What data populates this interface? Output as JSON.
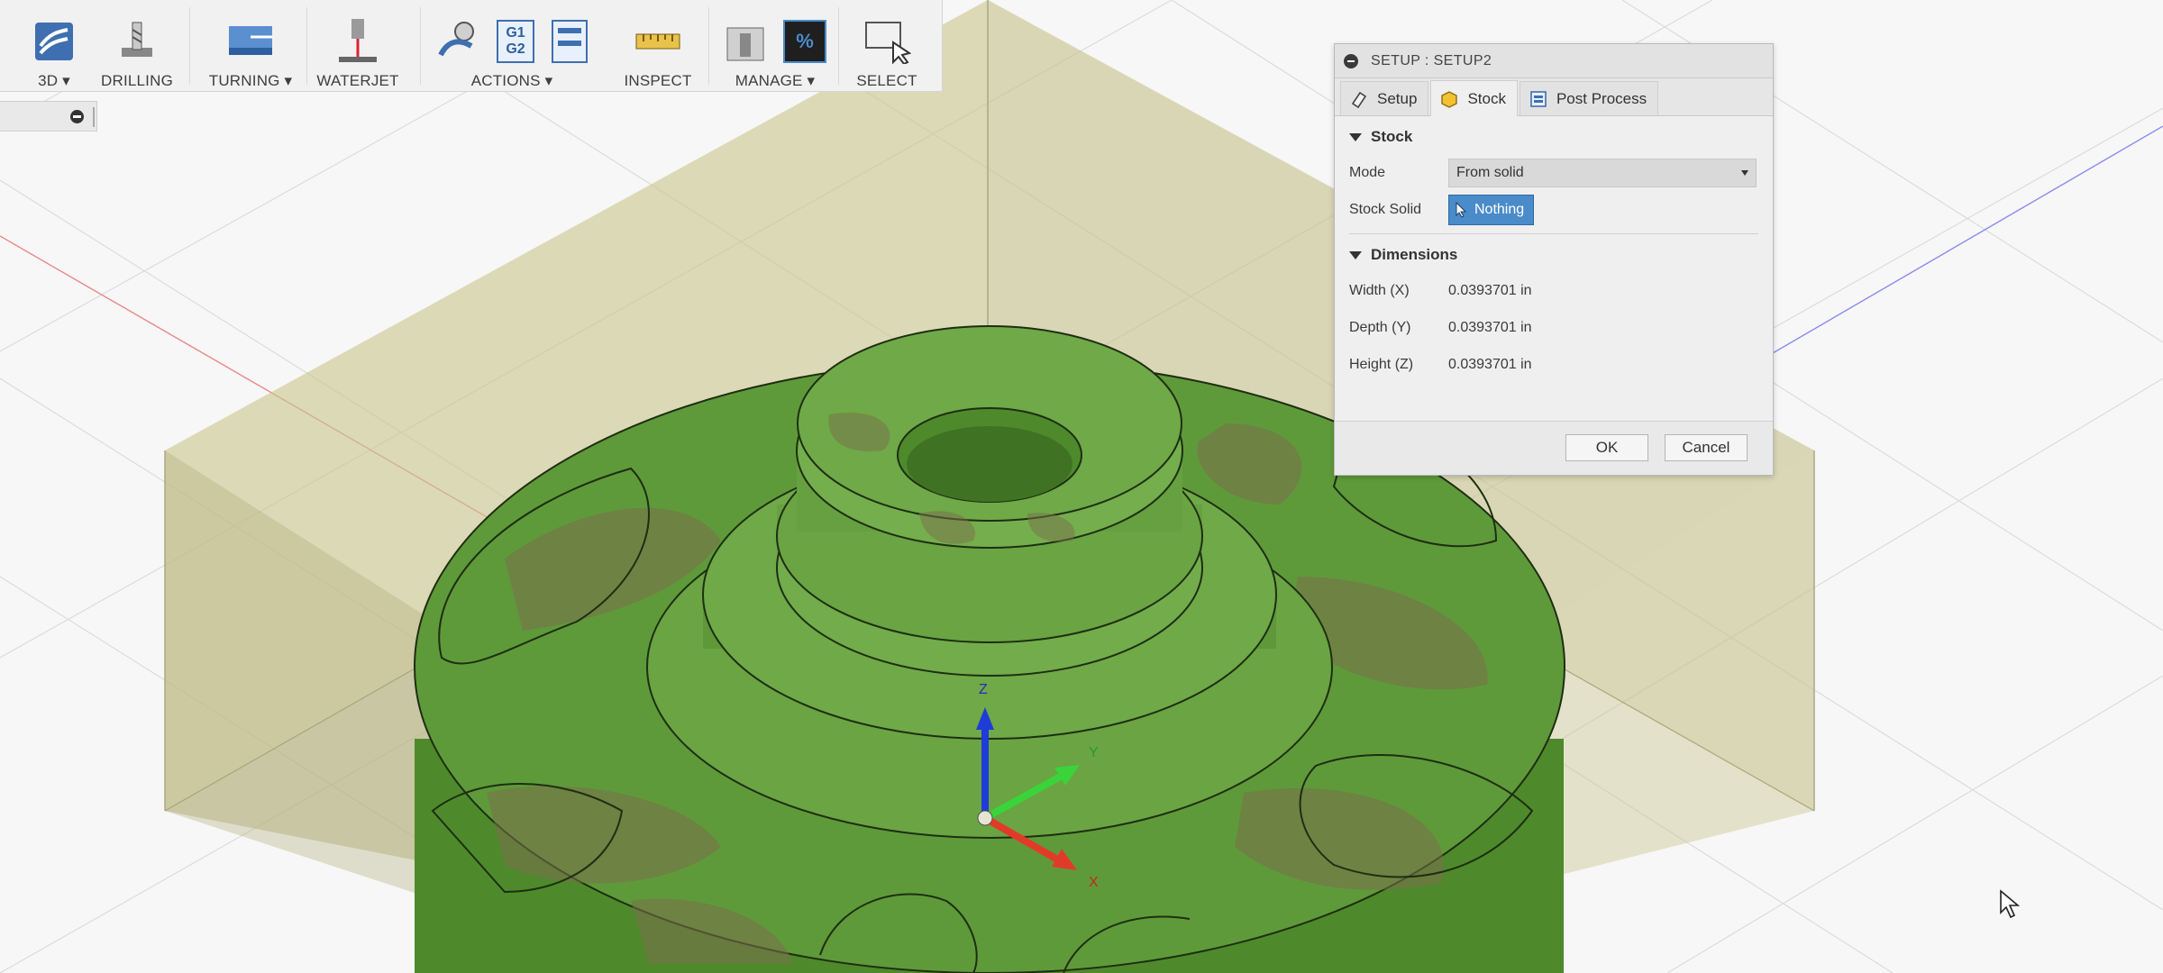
{
  "toolbar": {
    "items": [
      {
        "label": "3D ▾",
        "icon": "3d-milling-icon"
      },
      {
        "label": "DRILLING",
        "icon": "drill-icon"
      },
      {
        "label": "TURNING ▾",
        "icon": "turning-icon"
      },
      {
        "label": "WATERJET",
        "icon": "waterjet-icon"
      },
      {
        "label": "ACTIONS ▾",
        "icon": "simulate-icon"
      },
      {
        "label": "INSPECT",
        "icon": "measure-icon"
      },
      {
        "label": "MANAGE ▾",
        "icon": "tool-library-icon"
      },
      {
        "label": "SELECT",
        "icon": "select-icon"
      }
    ],
    "g1g2_top": "G1",
    "g1g2_bottom": "G2",
    "percent_glyph": "%"
  },
  "dialog": {
    "title": "SETUP : SETUP2",
    "tabs": [
      "Setup",
      "Stock",
      "Post Process"
    ],
    "stock_section": "Stock",
    "mode_label": "Mode",
    "mode_value": "From solid",
    "stock_solid_label": "Stock Solid",
    "stock_solid_value": "Nothing",
    "dimensions_section": "Dimensions",
    "width_label": "Width (X)",
    "width_value": "0.0393701 in",
    "depth_label": "Depth (Y)",
    "depth_value": "0.0393701 in",
    "height_label": "Height (Z)",
    "height_value": "0.0393701 in",
    "ok": "OK",
    "cancel": "Cancel"
  },
  "triad": {
    "z": "Z",
    "y": "Y",
    "x": "X"
  },
  "colors": {
    "model_green": "#5f9a3a",
    "stock_box": "#c7c38b",
    "selection_blue": "#4a8bc9",
    "axis_x": "#e23a2a",
    "axis_y": "#3ad43a",
    "axis_z": "#1f3bd8"
  }
}
